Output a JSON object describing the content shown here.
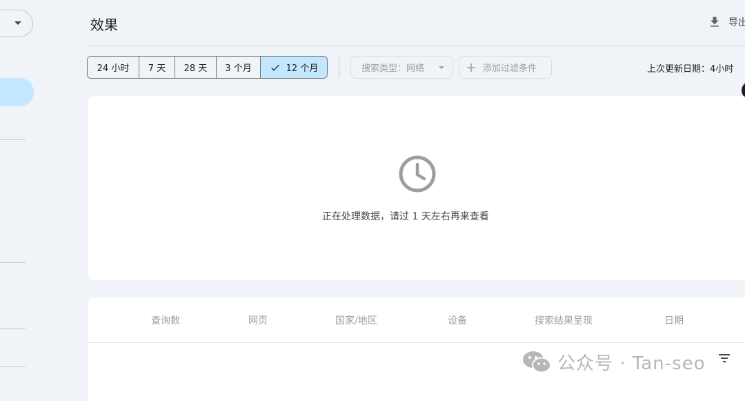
{
  "page": {
    "title": "效果"
  },
  "header": {
    "export_label": "导出"
  },
  "date_range": {
    "options": [
      "24 小时",
      "7 天",
      "28 天",
      "3 个月",
      "12 个月"
    ],
    "selected": "12 个月"
  },
  "filters": {
    "search_type": "搜索类型：网络",
    "add_filter": "添加过滤条件"
  },
  "last_updated": "上次更新日期：4小时",
  "empty_state": {
    "message": "正在处理数据，请过 1 天左右再来查看"
  },
  "table": {
    "tabs": [
      "查询数",
      "网页",
      "国家/地区",
      "设备",
      "搜索结果呈现",
      "日期"
    ]
  },
  "watermark": {
    "text": "公众号 · Tan-seo"
  },
  "colors": {
    "selected_bg": "#c2e7ff",
    "page_bg": "#f0f4f9"
  }
}
